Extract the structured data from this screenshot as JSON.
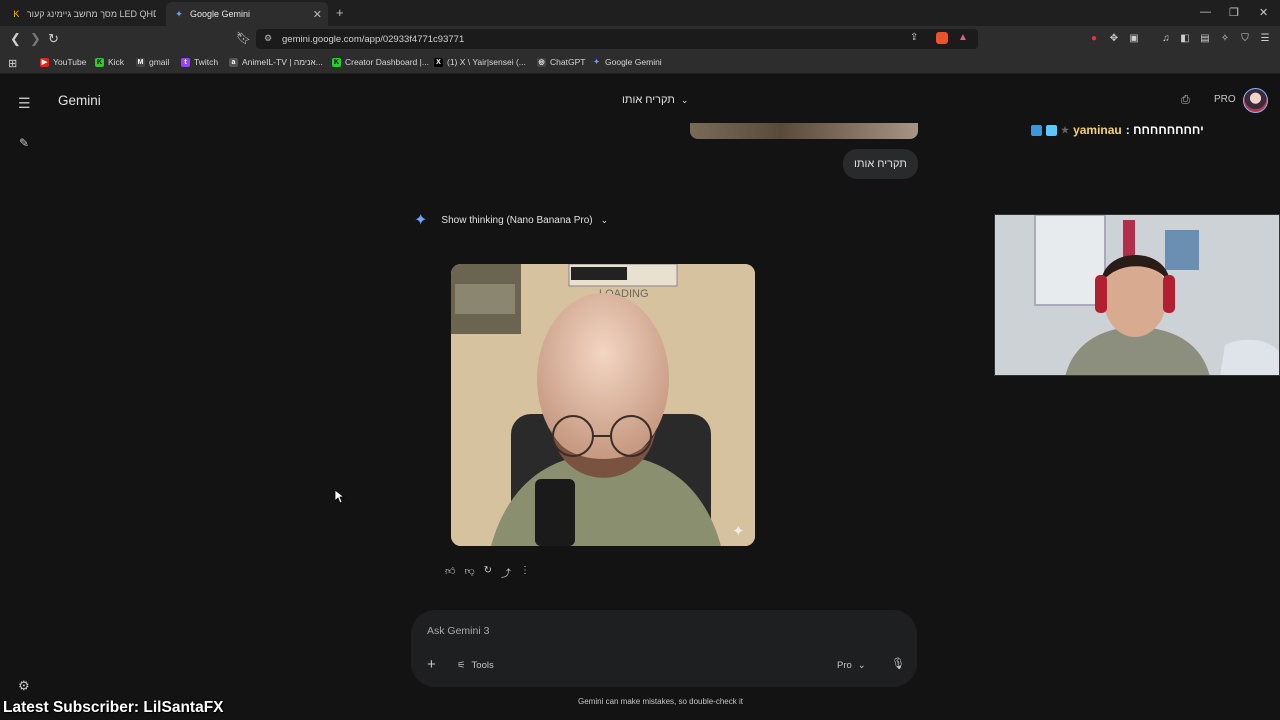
{
  "browser": {
    "tabs": [
      {
        "title": "מסך מחשב גיימינג קעור LED QHD VA",
        "active": false
      },
      {
        "title": "Google Gemini",
        "active": true
      }
    ],
    "url": "gemini.google.com/app/02933f4771c93771",
    "bookmarks": [
      "YouTube",
      "Kick",
      "gmail",
      "Twitch",
      "AnimeIL-TV | אנימה...",
      "Creator Dashboard |...",
      "(1) X \\ Yair|sensei (...",
      "ChatGPT",
      "Google Gemini"
    ]
  },
  "app": {
    "brand": "Gemini",
    "chat_title": "תקריח אותו",
    "plan_badge": "PRO"
  },
  "conversation": {
    "user_message": "תקריח אותו",
    "thinking_label": "Show thinking (Nano Banana Pro)",
    "image_text": "LOADING"
  },
  "composer": {
    "placeholder": "Ask Gemini 3",
    "tools_label": "Tools",
    "model_label": "Pro",
    "disclaimer": "Gemini can make mistakes, so double-check it"
  },
  "overlay": {
    "chat_user": "yaminau",
    "chat_message": ": יחחחחחחחח",
    "subscriber_banner": "Latest Subscriber: LilSantaFX"
  },
  "colors": {
    "background": "#131314",
    "accent": "#6ea3ff",
    "chat_name": "#f4d27a"
  }
}
